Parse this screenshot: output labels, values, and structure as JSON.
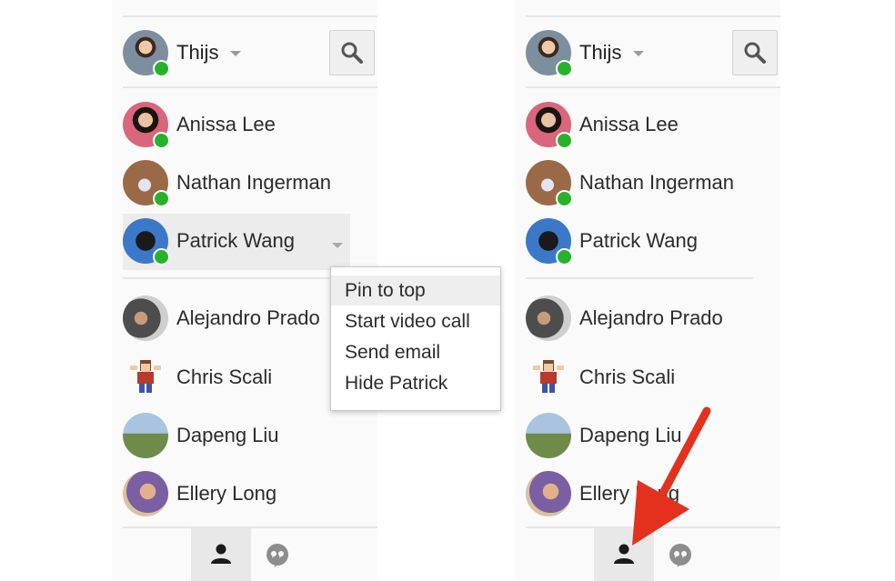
{
  "left_panel": {
    "owner": {
      "name": "Thijs",
      "status": "online"
    },
    "contacts": [
      {
        "name": "Anissa Lee",
        "online": true
      },
      {
        "name": "Nathan Ingerman",
        "online": true
      },
      {
        "name": "Patrick Wang",
        "online": true,
        "highlighted": true
      },
      {
        "name": "Alejandro Prado",
        "online": false
      },
      {
        "name": "Chris Scali",
        "online": false
      },
      {
        "name": "Dapeng Liu",
        "online": false
      },
      {
        "name": "Ellery Long",
        "online": false
      }
    ],
    "context_menu": {
      "items": [
        "Pin to top",
        "Start video call",
        "Send email",
        "Hide Patrick"
      ],
      "active_index": 0
    }
  },
  "right_panel": {
    "owner": {
      "name": "Thijs",
      "status": "online"
    },
    "contacts": [
      {
        "name": "Anissa Lee",
        "online": true
      },
      {
        "name": "Nathan Ingerman",
        "online": true
      },
      {
        "name": "Patrick Wang",
        "online": true
      },
      {
        "name": "Alejandro Prado",
        "online": false
      },
      {
        "name": "Chris Scali",
        "online": false
      },
      {
        "name": "Dapeng Liu",
        "online": false
      },
      {
        "name": "Ellery Long",
        "online": false
      }
    ]
  },
  "icons": {
    "search": "search-icon",
    "people_tab": "person-icon",
    "chat_tab": "quote-chat-icon",
    "annotation": "red-arrow"
  },
  "colors": {
    "online": "#27b22b",
    "arrow": "#e3311d",
    "divider": "#e6e6e6"
  }
}
